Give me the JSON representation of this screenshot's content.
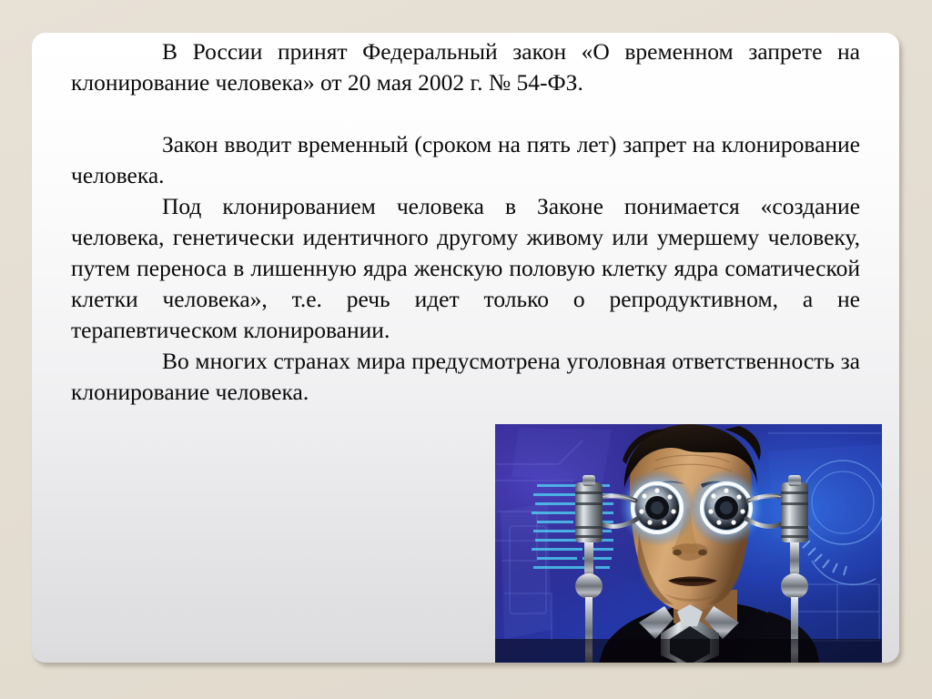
{
  "slide": {
    "background_color": "#e4ddd2",
    "card_color_top": "#ffffff",
    "card_color_bottom": "#dcdcde",
    "paragraphs": [
      "В России принят Федеральный закон «О временном запрете на клонирование человека» от 20 мая 2002 г. № 54-ФЗ.",
      "Закон вводит временный (сроком на пять лет) запрет на клонирование человека.",
      "Под клонированием человека в Законе понимается «создание человека, генетически идентичного другому живому или умершему человеку, путем переноса в лишенную ядра женскую половую клетку ядра соматической клетки человека», т.е. речь идет только о репродуктивном, а не терапевтическом клонировании.",
      "Во многих странах мира предусмотрена уголовная ответственность за клонирование человека."
    ],
    "image": {
      "name": "the-sixth-day-poster",
      "description": "Лицо мужчины с оптическими сканерами на глазах на синем технологическом фоне",
      "alt": "Мужчина со светящимися оптическими приборами у глаз",
      "colors": {
        "background_blue": "#2a2a8c",
        "glow": "#cfe8ff",
        "skin": "#c49a6a",
        "metal": "#b9bcc2",
        "dark": "#07060f"
      }
    }
  }
}
